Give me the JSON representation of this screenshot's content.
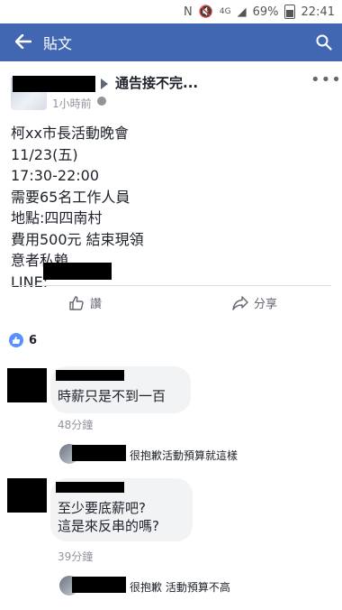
{
  "status_bar": {
    "network": "4G",
    "battery": "69%",
    "time": "22:41"
  },
  "app_bar": {
    "back_icon": "back-arrow-icon",
    "title": "貼文",
    "search_icon": "search-icon"
  },
  "post": {
    "title": "通告接不完...",
    "time": "1小時前",
    "body_lines": [
      "柯xx市長活動晚會",
      "11/23(五)",
      "17:30-22:00",
      "需要65名工作人員",
      "地點:四四南村",
      "費用500元 結束現領",
      "意者私賴",
      "LINE:"
    ],
    "like_label": "讚",
    "share_label": "分享"
  },
  "reactions": {
    "count": "6"
  },
  "comments": [
    {
      "text_lines": [
        "時薪只是不到一百"
      ],
      "time": "48分鐘",
      "reply": "很抱歉活動預算就這樣"
    },
    {
      "text_lines": [
        "至少要底薪吧?",
        "這是來反串的嗎?"
      ],
      "time": "39分鐘",
      "reply": "很抱歉 活動預算不高"
    }
  ],
  "colors": {
    "app_bar": "#4267b2",
    "like_badge": "#5890ff",
    "bubble": "#f2f3f5"
  }
}
